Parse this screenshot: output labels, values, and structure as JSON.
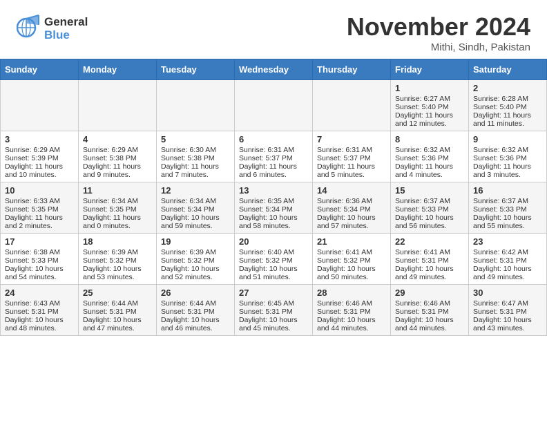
{
  "header": {
    "logo_line1": "General",
    "logo_line2": "Blue",
    "month": "November 2024",
    "location": "Mithi, Sindh, Pakistan"
  },
  "weekdays": [
    "Sunday",
    "Monday",
    "Tuesday",
    "Wednesday",
    "Thursday",
    "Friday",
    "Saturday"
  ],
  "weeks": [
    [
      {
        "day": "",
        "text": ""
      },
      {
        "day": "",
        "text": ""
      },
      {
        "day": "",
        "text": ""
      },
      {
        "day": "",
        "text": ""
      },
      {
        "day": "",
        "text": ""
      },
      {
        "day": "1",
        "text": "Sunrise: 6:27 AM\nSunset: 5:40 PM\nDaylight: 11 hours and 12 minutes."
      },
      {
        "day": "2",
        "text": "Sunrise: 6:28 AM\nSunset: 5:40 PM\nDaylight: 11 hours and 11 minutes."
      }
    ],
    [
      {
        "day": "3",
        "text": "Sunrise: 6:29 AM\nSunset: 5:39 PM\nDaylight: 11 hours and 10 minutes."
      },
      {
        "day": "4",
        "text": "Sunrise: 6:29 AM\nSunset: 5:38 PM\nDaylight: 11 hours and 9 minutes."
      },
      {
        "day": "5",
        "text": "Sunrise: 6:30 AM\nSunset: 5:38 PM\nDaylight: 11 hours and 7 minutes."
      },
      {
        "day": "6",
        "text": "Sunrise: 6:31 AM\nSunset: 5:37 PM\nDaylight: 11 hours and 6 minutes."
      },
      {
        "day": "7",
        "text": "Sunrise: 6:31 AM\nSunset: 5:37 PM\nDaylight: 11 hours and 5 minutes."
      },
      {
        "day": "8",
        "text": "Sunrise: 6:32 AM\nSunset: 5:36 PM\nDaylight: 11 hours and 4 minutes."
      },
      {
        "day": "9",
        "text": "Sunrise: 6:32 AM\nSunset: 5:36 PM\nDaylight: 11 hours and 3 minutes."
      }
    ],
    [
      {
        "day": "10",
        "text": "Sunrise: 6:33 AM\nSunset: 5:35 PM\nDaylight: 11 hours and 2 minutes."
      },
      {
        "day": "11",
        "text": "Sunrise: 6:34 AM\nSunset: 5:35 PM\nDaylight: 11 hours and 0 minutes."
      },
      {
        "day": "12",
        "text": "Sunrise: 6:34 AM\nSunset: 5:34 PM\nDaylight: 10 hours and 59 minutes."
      },
      {
        "day": "13",
        "text": "Sunrise: 6:35 AM\nSunset: 5:34 PM\nDaylight: 10 hours and 58 minutes."
      },
      {
        "day": "14",
        "text": "Sunrise: 6:36 AM\nSunset: 5:34 PM\nDaylight: 10 hours and 57 minutes."
      },
      {
        "day": "15",
        "text": "Sunrise: 6:37 AM\nSunset: 5:33 PM\nDaylight: 10 hours and 56 minutes."
      },
      {
        "day": "16",
        "text": "Sunrise: 6:37 AM\nSunset: 5:33 PM\nDaylight: 10 hours and 55 minutes."
      }
    ],
    [
      {
        "day": "17",
        "text": "Sunrise: 6:38 AM\nSunset: 5:33 PM\nDaylight: 10 hours and 54 minutes."
      },
      {
        "day": "18",
        "text": "Sunrise: 6:39 AM\nSunset: 5:32 PM\nDaylight: 10 hours and 53 minutes."
      },
      {
        "day": "19",
        "text": "Sunrise: 6:39 AM\nSunset: 5:32 PM\nDaylight: 10 hours and 52 minutes."
      },
      {
        "day": "20",
        "text": "Sunrise: 6:40 AM\nSunset: 5:32 PM\nDaylight: 10 hours and 51 minutes."
      },
      {
        "day": "21",
        "text": "Sunrise: 6:41 AM\nSunset: 5:32 PM\nDaylight: 10 hours and 50 minutes."
      },
      {
        "day": "22",
        "text": "Sunrise: 6:41 AM\nSunset: 5:31 PM\nDaylight: 10 hours and 49 minutes."
      },
      {
        "day": "23",
        "text": "Sunrise: 6:42 AM\nSunset: 5:31 PM\nDaylight: 10 hours and 49 minutes."
      }
    ],
    [
      {
        "day": "24",
        "text": "Sunrise: 6:43 AM\nSunset: 5:31 PM\nDaylight: 10 hours and 48 minutes."
      },
      {
        "day": "25",
        "text": "Sunrise: 6:44 AM\nSunset: 5:31 PM\nDaylight: 10 hours and 47 minutes."
      },
      {
        "day": "26",
        "text": "Sunrise: 6:44 AM\nSunset: 5:31 PM\nDaylight: 10 hours and 46 minutes."
      },
      {
        "day": "27",
        "text": "Sunrise: 6:45 AM\nSunset: 5:31 PM\nDaylight: 10 hours and 45 minutes."
      },
      {
        "day": "28",
        "text": "Sunrise: 6:46 AM\nSunset: 5:31 PM\nDaylight: 10 hours and 44 minutes."
      },
      {
        "day": "29",
        "text": "Sunrise: 6:46 AM\nSunset: 5:31 PM\nDaylight: 10 hours and 44 minutes."
      },
      {
        "day": "30",
        "text": "Sunrise: 6:47 AM\nSunset: 5:31 PM\nDaylight: 10 hours and 43 minutes."
      }
    ]
  ]
}
